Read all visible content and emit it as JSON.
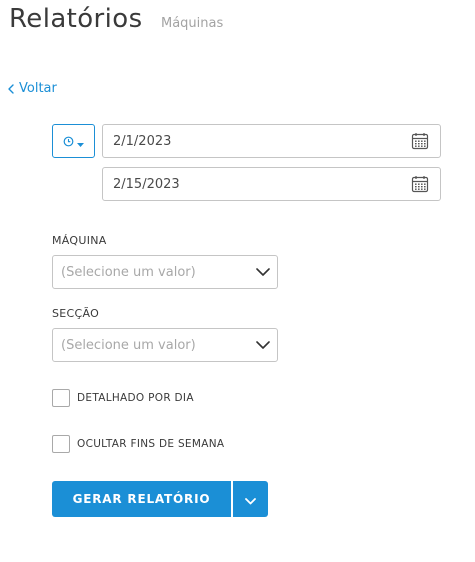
{
  "header": {
    "title": "Relatórios",
    "subtitle": "Máquinas"
  },
  "nav": {
    "back_label": "Voltar",
    "back_icon": "chevron-left-icon"
  },
  "date_range": {
    "mode_icon": "clock-icon",
    "start_date": "2/1/2023",
    "end_date": "2/15/2023",
    "calendar_icon": "calendar-icon"
  },
  "filters": {
    "machine": {
      "label": "MÁQUINA",
      "placeholder": "(Selecione um valor)"
    },
    "section": {
      "label": "SECÇÃO",
      "placeholder": "(Selecione um valor)"
    }
  },
  "options": {
    "detailed_per_day": {
      "label": "DETALHADO POR DIA",
      "checked": false
    },
    "hide_weekends": {
      "label": "OCULTAR FINS DE SEMANA",
      "checked": false
    }
  },
  "actions": {
    "generate_label": "GERAR RELATÓRIO"
  },
  "colors": {
    "accent": "#1b8fd6",
    "border": "#c5c5c5",
    "placeholder": "#a8a8a8"
  }
}
